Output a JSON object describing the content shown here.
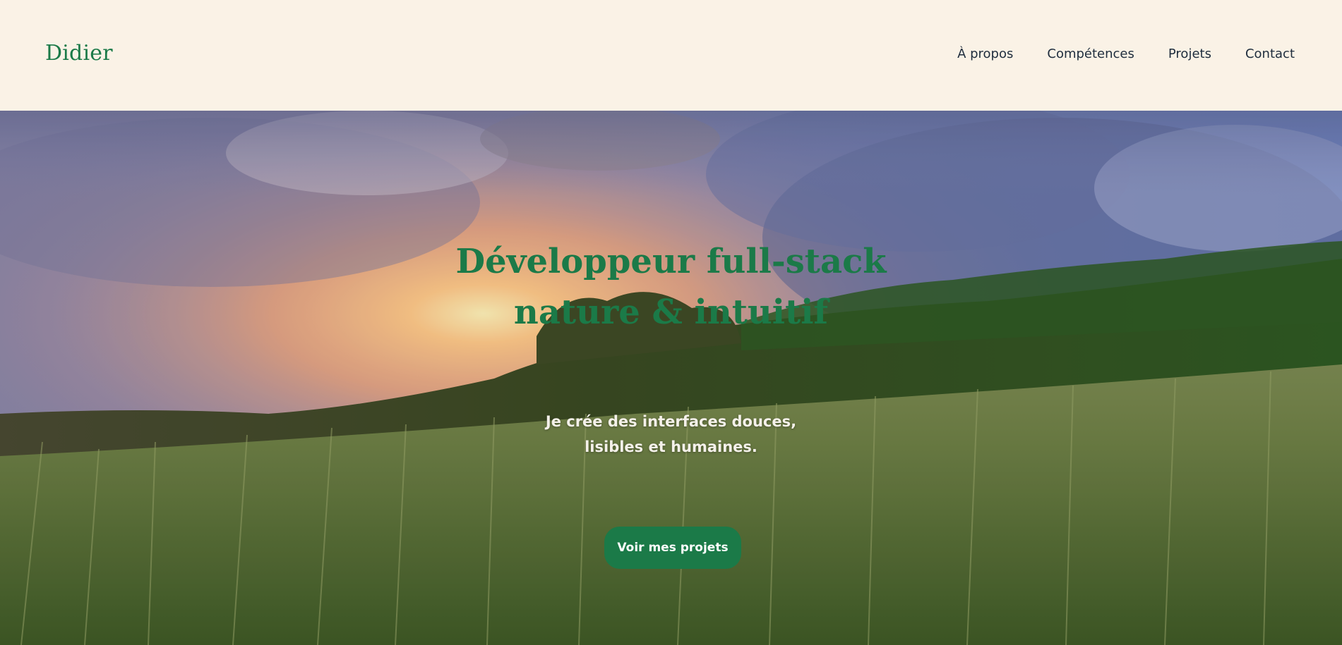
{
  "header": {
    "logo": "Didier",
    "nav": [
      {
        "label": "À propos"
      },
      {
        "label": "Compétences"
      },
      {
        "label": "Projets"
      },
      {
        "label": "Contact"
      }
    ]
  },
  "hero": {
    "title_line1": "Développeur full-stack",
    "title_line2": "nature & intuitif",
    "subtitle_line1": "Je crée des interfaces douces,",
    "subtitle_line2": "lisibles et humaines.",
    "cta_label": "Voir mes projets",
    "background_image": "sunset-wheat-field-landscape"
  },
  "colors": {
    "accent": "#1b7a48",
    "header_bg": "#faf2e6",
    "nav_text": "#1f2d3d"
  }
}
